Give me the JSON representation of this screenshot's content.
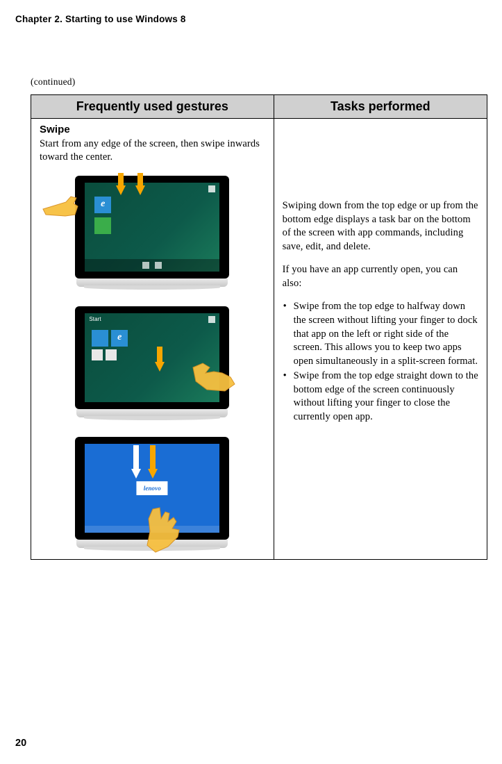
{
  "header": {
    "chapter_title": "Chapter 2. Starting to use Windows 8"
  },
  "continued_label": "(continued)",
  "table": {
    "col1_header": "Frequently used gestures",
    "col2_header": "Tasks performed",
    "gesture_name": "Swipe",
    "gesture_desc": "Start from any edge of the screen, then swipe inwards toward the center.",
    "tablet2_start_label": "Start",
    "tablet3_logo": "lenovo",
    "right_p1": "Swiping down from the top edge or up from the bottom edge displays a task bar on the bottom of the screen with app commands, including save, edit, and delete.",
    "right_p2": "If you have an app currently open, you can also:",
    "right_li1": "Swipe from the top edge to halfway down the screen without lifting your finger to dock that app on the left or right side of the screen. This allows you to keep two apps open simultaneously in a split-screen format.",
    "right_li2": "Swipe from the top edge straight down to the bottom edge of the screen continuously without lifting your finger to close the currently open app."
  },
  "page_number": "20"
}
